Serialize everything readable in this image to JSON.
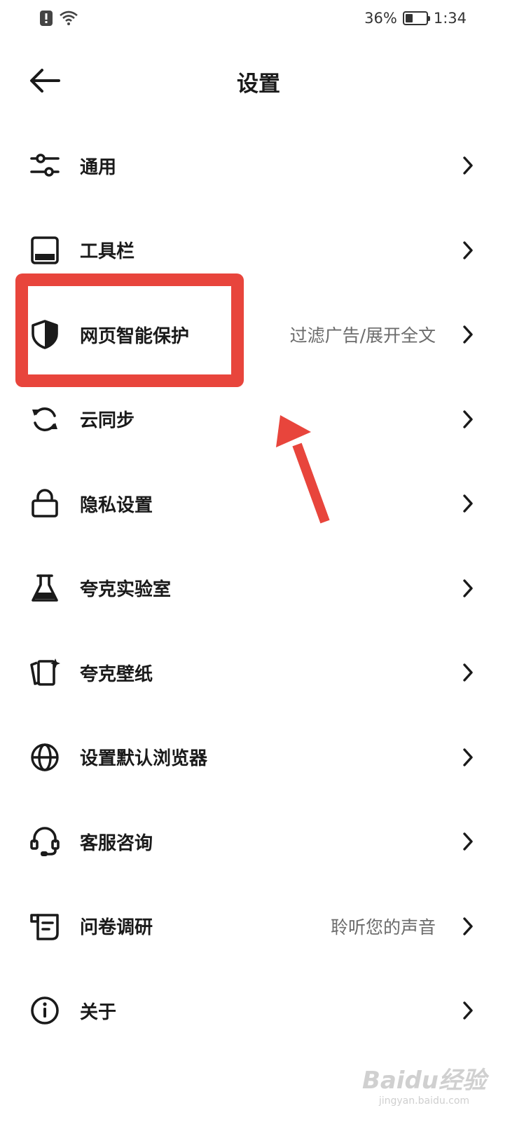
{
  "status_bar": {
    "battery": "36%",
    "battery_level": 0.36,
    "time": "1:34"
  },
  "header": {
    "title": "设置"
  },
  "items": [
    {
      "label": "通用",
      "value": "",
      "icon": "sliders-icon"
    },
    {
      "label": "工具栏",
      "value": "",
      "icon": "toolbar-icon"
    },
    {
      "label": "网页智能保护",
      "value": "过滤广告/展开全文",
      "icon": "shield-icon"
    },
    {
      "label": "云同步",
      "value": "",
      "icon": "sync-icon"
    },
    {
      "label": "隐私设置",
      "value": "",
      "icon": "lock-icon"
    },
    {
      "label": "夸克实验室",
      "value": "",
      "icon": "flask-icon"
    },
    {
      "label": "夸克壁纸",
      "value": "",
      "icon": "wallpaper-icon"
    },
    {
      "label": "设置默认浏览器",
      "value": "",
      "icon": "globe-icon"
    },
    {
      "label": "客服咨询",
      "value": "",
      "icon": "headset-icon"
    },
    {
      "label": "问卷调研",
      "value": "聆听您的声音",
      "icon": "survey-icon"
    },
    {
      "label": "关于",
      "value": "",
      "icon": "info-icon"
    }
  ],
  "annotation": {
    "color": "#e8453c"
  },
  "watermark": {
    "logo": "Baidu经验",
    "url": "jingyan.baidu.com"
  }
}
